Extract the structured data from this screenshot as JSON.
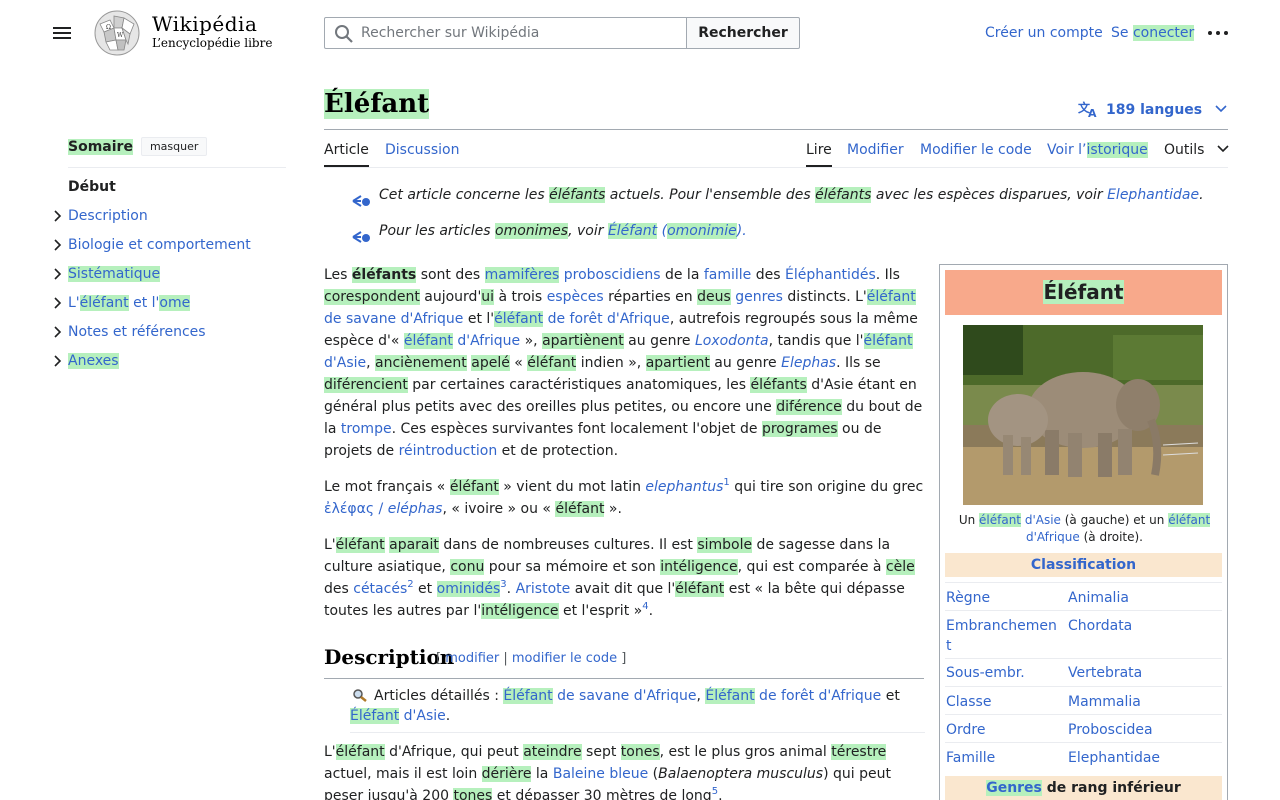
{
  "header": {
    "wordmark": "Wikipédia",
    "tagline": "L’encyclopédie libre",
    "search_placeholder": "Rechercher sur Wikipédia",
    "search_button": "Rechercher",
    "create_account": "Créer un compte",
    "login_pre": "Se ",
    "login_hl": "conecter"
  },
  "toc": {
    "title": "Somaire",
    "hide": "masquer",
    "items": [
      "Début",
      "Description",
      "Biologie et comportement",
      "Sistématique",
      "L'",
      "éléfant",
      " et l'",
      "ome",
      "Notes et références",
      "Anexes"
    ]
  },
  "title": "Éléfant",
  "languages": "189 langues",
  "tabs": {
    "article": "Article",
    "discussion": "Discussion",
    "read": "Lire",
    "edit": "Modifier",
    "edit_code": "Modifier le code",
    "history_pre": "Voir l’",
    "history_hl": "istorique",
    "tools": "Outils"
  },
  "hatnotes": {
    "h1_a": "Cet article concerne les ",
    "h1_b": "éléfants",
    "h1_c": " actuels. Pour l'ensemble des ",
    "h1_d": "éléfants",
    "h1_e": " avec les espèces disparues, voir ",
    "h1_link": "Elephantidae",
    "h1_f": ".",
    "h2_a": "Pour les articles ",
    "h2_b": "omonimes",
    "h2_c": ", voir ",
    "h2_link1": "Éléfant",
    "h2_d": " (",
    "h2_link2": "omonimie",
    "h2_e": ")."
  },
  "section": {
    "heading": "Description",
    "edit_open": "[ ",
    "edit": "modifier",
    "sep": " | ",
    "edit_code": "modifier le code",
    "edit_close": " ]",
    "detail_label": "Articles détaillés : ",
    "detail_l1a": "Éléfant",
    "detail_l1b": " de savane d'Afrique",
    "detail_comma": ", ",
    "detail_l2a": "Éléfant",
    "detail_l2b": " de forêt d'Afrique",
    "detail_et": " et",
    "detail_l3a": "Éléfant",
    "detail_l3b": " d'Asie",
    "detail_dot": "."
  },
  "infobox": {
    "title": "Éléfant",
    "caption_a": "Un ",
    "caption_b": "éléfant",
    "caption_c": " d'Asie",
    "caption_d": " (à gauche) et un ",
    "caption_e": "éléfant",
    "caption_f": "d'Afrique",
    "caption_g": " (à droite).",
    "classification": "Classification",
    "rows": [
      {
        "k": "Règne",
        "v": "Animalia"
      },
      {
        "k": "Embranchemen",
        "k2": "t",
        "v": "Chordata"
      },
      {
        "k": "Sous-embr.",
        "v": "Vertebrata"
      },
      {
        "k": "Classe",
        "v": "Mammalia"
      },
      {
        "k": "Ordre",
        "v": "Proboscidea"
      },
      {
        "k": "Famille",
        "v": "Elephantidae"
      }
    ],
    "genres_hl": "Genres",
    "genres_rest": " de rang inférieur"
  }
}
